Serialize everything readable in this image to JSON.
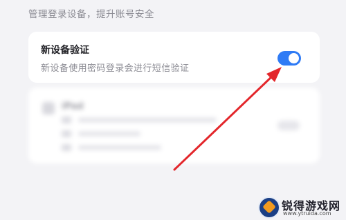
{
  "section": {
    "caption": "管理登录设备，提升账号安全"
  },
  "new_device_verification": {
    "title": "新设备验证",
    "description": "新设备使用密码登录会进行短信验证",
    "toggle_on": true,
    "toggle_color": "#2f7bf5"
  },
  "annotation": {
    "arrow_color": "#e3262b"
  },
  "watermark": {
    "name": "锐得游戏网",
    "url": "www.ytruida.com"
  }
}
